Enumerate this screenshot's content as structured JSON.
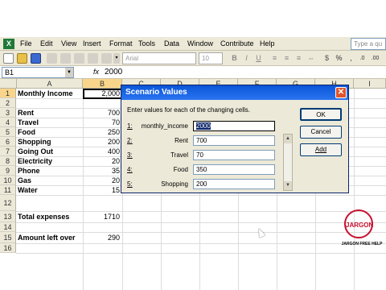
{
  "menu": {
    "items": [
      "File",
      "Edit",
      "View",
      "Insert",
      "Format",
      "Tools",
      "Data",
      "Window",
      "Contribute",
      "Help"
    ],
    "help_placeholder": "Type a qu"
  },
  "toolbar": {
    "font_name": "Arial",
    "font_size": "10"
  },
  "formula_bar": {
    "name_box": "B1",
    "fx": "fx",
    "value": "2000"
  },
  "sheet": {
    "columns": [
      "A",
      "B",
      "C",
      "D",
      "E",
      "F",
      "G",
      "H",
      "I"
    ],
    "selected_column": "B",
    "selected_row": "1",
    "rows": [
      {
        "num": "1",
        "a": "Monthly Income",
        "b": "2,000"
      },
      {
        "num": "2",
        "a": "",
        "b": ""
      },
      {
        "num": "3",
        "a": "Rent",
        "b": "700"
      },
      {
        "num": "4",
        "a": "Travel",
        "b": "70"
      },
      {
        "num": "5",
        "a": "Food",
        "b": "250"
      },
      {
        "num": "6",
        "a": "Shopping",
        "b": "200"
      },
      {
        "num": "7",
        "a": "Going Out",
        "b": "400"
      },
      {
        "num": "8",
        "a": "Electricity",
        "b": "20"
      },
      {
        "num": "9",
        "a": "Phone",
        "b": "35"
      },
      {
        "num": "10",
        "a": "Gas",
        "b": "20"
      },
      {
        "num": "11",
        "a": "Water",
        "b": "15"
      },
      {
        "num": "12",
        "a": "",
        "b": ""
      },
      {
        "num": "13",
        "a": "Total expenses",
        "b": "1710"
      },
      {
        "num": "14",
        "a": "",
        "b": ""
      },
      {
        "num": "15",
        "a": "Amount left over",
        "b": "290"
      },
      {
        "num": "16",
        "a": "",
        "b": ""
      }
    ]
  },
  "dialog": {
    "title": "Scenario Values",
    "prompt": "Enter values for each of the changing cells.",
    "rows": [
      {
        "num": "1:",
        "label": "monthly_income",
        "value": "2000"
      },
      {
        "num": "2:",
        "label": "Rent",
        "value": "700"
      },
      {
        "num": "3:",
        "label": "Travel",
        "value": "70"
      },
      {
        "num": "4:",
        "label": "Food",
        "value": "350"
      },
      {
        "num": "5:",
        "label": "Shopping",
        "value": "200"
      }
    ],
    "ok_label": "OK",
    "cancel_label": "Cancel",
    "add_label": "Add"
  },
  "watermark": {
    "logo_text": "JARGON",
    "caption": "JARGON FREE HELP"
  }
}
